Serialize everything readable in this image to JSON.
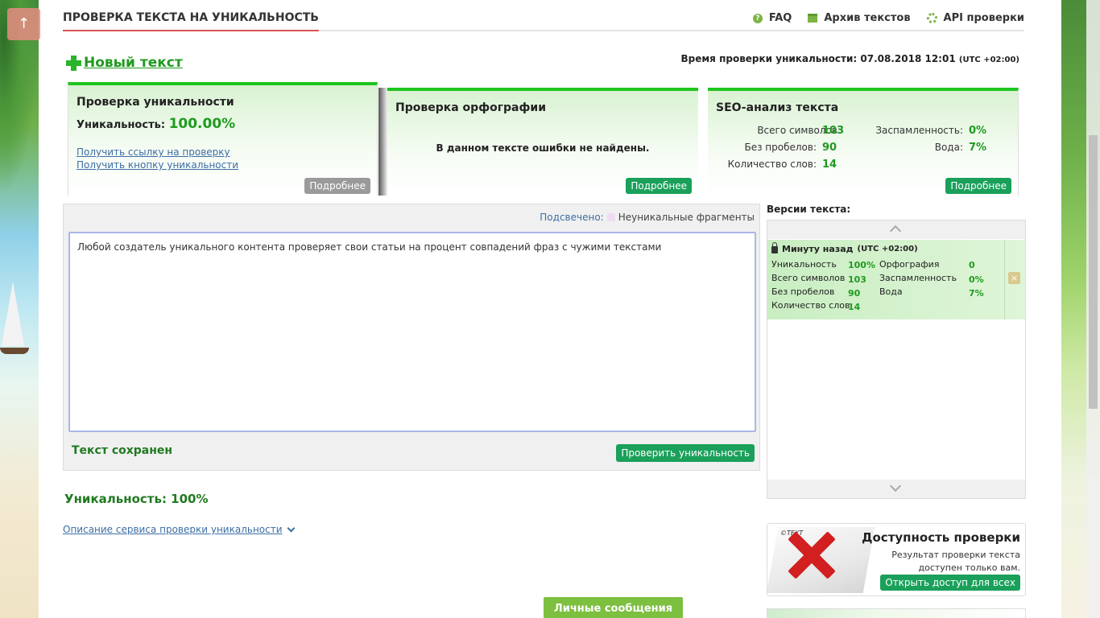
{
  "header": {
    "title": "Проверка текста на уникальность",
    "nav": [
      {
        "label": "FAQ",
        "icon": "question-icon"
      },
      {
        "label": "Архив текстов",
        "icon": "archive-icon"
      },
      {
        "label": "API проверки",
        "icon": "gear-icon"
      }
    ],
    "scroll_up_glyph": "↑"
  },
  "new_text_label": "Новый текст",
  "check_time": {
    "label": "Время проверки уникальности:",
    "value": "07.08.2018 12:01",
    "tz": "(UTC +02:00)"
  },
  "cards": {
    "uniqueness": {
      "title": "Проверка уникальности",
      "label": "Уникальность:",
      "value": "100.00%",
      "links": [
        "Получить ссылку на проверку",
        "Получить кнопку уникальности"
      ],
      "more": "Подробнее"
    },
    "spelling": {
      "title": "Проверка орфографии",
      "message": "В данном тексте ошибки не найдены.",
      "more": "Подробнее"
    },
    "seo": {
      "title": "SEO-анализ текста",
      "total_chars_label": "Всего символов:",
      "total_chars": "103",
      "no_spaces_label": "Без пробелов:",
      "no_spaces": "90",
      "words_label": "Количество слов:",
      "words": "14",
      "spam_label": "Заспамленность:",
      "spam": "0%",
      "water_label": "Вода:",
      "water": "7%",
      "more": "Подробнее"
    }
  },
  "editor": {
    "highlight_label": "Подсвечено:",
    "highlight_legend": "Неуникальные фрагменты",
    "text": "Любой создатель уникального контента проверяет свои статьи на процент совпадений фраз с чужими текстами",
    "saved_status": "Текст сохранен",
    "check_button": "Проверить уникальность"
  },
  "result": "Уникальность: 100%",
  "description_link": "Описание сервиса проверки уникальности",
  "versions": {
    "title": "Версии текста:",
    "items": [
      {
        "time": "Минуту назад",
        "tz": "(UTC +02:00)",
        "uniq_label": "Уникальность",
        "uniq": "100%",
        "chars_label": "Всего символов",
        "chars": "103",
        "nospace_label": "Без пробелов",
        "nospace": "90",
        "words_label": "Количество слов",
        "words": "14",
        "spell_label": "Орфография",
        "spell": "0",
        "spam_label": "Заспамленность",
        "spam": "0%",
        "water_label": "Вода",
        "water": "7%",
        "delete_glyph": "×"
      }
    ]
  },
  "access": {
    "title": "Доступность проверки",
    "text": "Результат проверки текста доступен только вам.",
    "button": "Открыть доступ для всех",
    "doc_mark": "©TEXT"
  },
  "messages_button": "Личные сообщения",
  "colors": {
    "accent_green": "#1aa05a",
    "value_green": "#1f9a1f",
    "title_underline": "#d9534f",
    "card_top": "#1ec41e"
  }
}
